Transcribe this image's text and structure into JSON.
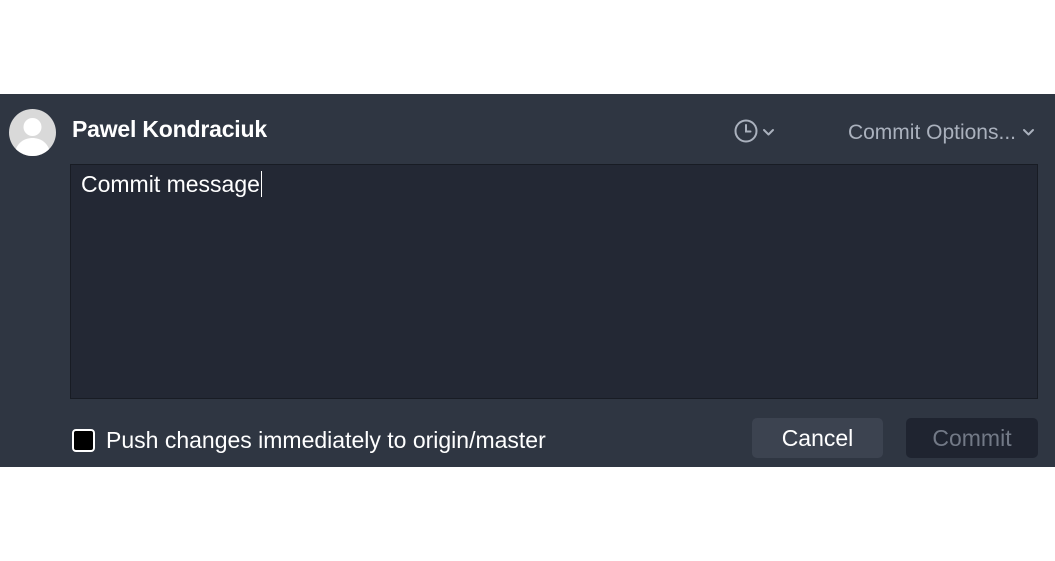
{
  "author": {
    "name": "Pawel Kondraciuk",
    "avatar_icon": "user-avatar-icon"
  },
  "toolbar": {
    "history_icon": "clock-icon",
    "commit_options_label": "Commit Options...",
    "dropdown_icon": "chevron-down-icon"
  },
  "message": {
    "value": "Commit message"
  },
  "push": {
    "label": "Push changes immediately to origin/master",
    "checked": false
  },
  "buttons": {
    "cancel_label": "Cancel",
    "commit_label": "Commit"
  },
  "colors": {
    "panel_bg": "#2f3642",
    "editor_bg": "#232834",
    "muted_text": "#aab1bd",
    "disabled_text": "#727986"
  }
}
